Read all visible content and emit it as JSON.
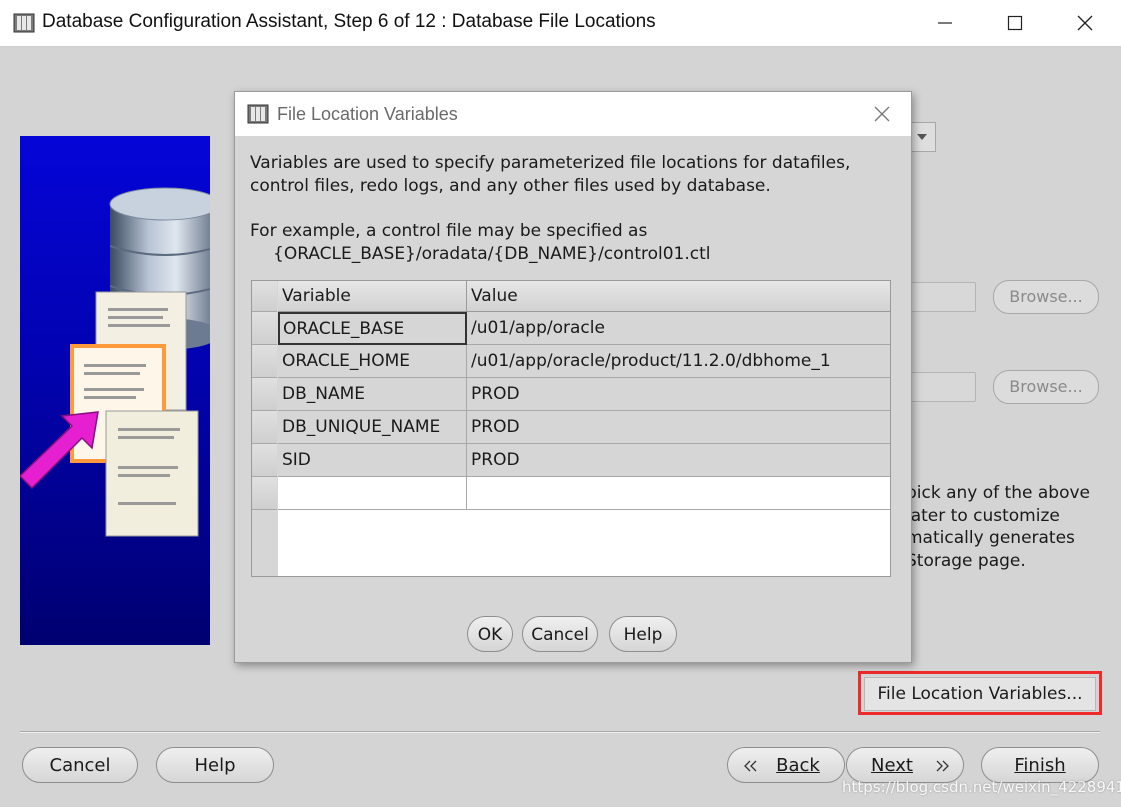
{
  "window": {
    "title": "Database Configuration Assistant, Step 6 of 12 : Database File Locations",
    "icons": [
      "app-icon",
      "minimize-icon",
      "maximize-icon",
      "close-icon"
    ]
  },
  "background": {
    "browse_label": "Browse...",
    "text_lines": [
      "pick any of the above",
      "later to customize",
      "matically generates",
      "Storage page."
    ],
    "file_location_variables_label": "File Location Variables...",
    "highlight_color": "#ee2a2a"
  },
  "footer": {
    "cancel_label": "Cancel",
    "help_label": "Help",
    "back_label": "Back",
    "next_label": "Next",
    "finish_label": "Finish",
    "watermark": "https://blog.csdn.net/weixin_42289413"
  },
  "dialog": {
    "title": "File Location Variables",
    "description_line1": "Variables are used to specify parameterized file locations for datafiles,",
    "description_line2": "control files, redo logs, and any other files used by database.",
    "example_line1": "For example, a control file may be specified as",
    "example_line2": "{ORACLE_BASE}/oradata/{DB_NAME}/control01.ctl",
    "table": {
      "columns": [
        "Variable",
        "Value"
      ],
      "rows": [
        {
          "variable": "ORACLE_BASE",
          "value": "/u01/app/oracle"
        },
        {
          "variable": "ORACLE_HOME",
          "value": "/u01/app/oracle/product/11.2.0/dbhome_1"
        },
        {
          "variable": "DB_NAME",
          "value": "PROD"
        },
        {
          "variable": "DB_UNIQUE_NAME",
          "value": "PROD"
        },
        {
          "variable": "SID",
          "value": "PROD"
        },
        {
          "variable": "",
          "value": ""
        }
      ]
    },
    "ok_label": "OK",
    "cancel_label": "Cancel",
    "help_label": "Help"
  }
}
